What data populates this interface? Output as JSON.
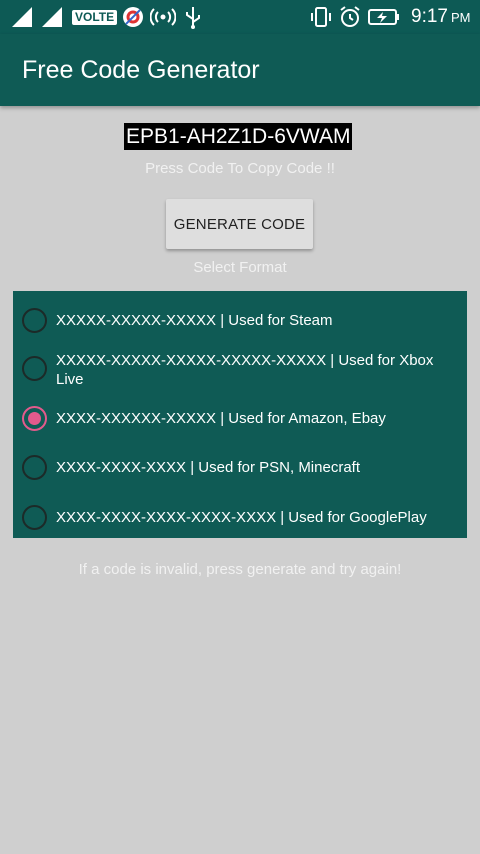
{
  "status_bar": {
    "network_badge": "VOLTE",
    "time": "9:17",
    "ampm": "PM",
    "icons": [
      "signal-icon",
      "signal-icon",
      "volte-badge",
      "app-notification-icon",
      "hotspot-icon",
      "usb-icon",
      "vibrate-icon",
      "alarm-icon",
      "battery-charging-icon"
    ]
  },
  "app_bar": {
    "title": "Free Code Generator"
  },
  "code": {
    "value": "EPB1-AH2Z1D-6VWAM",
    "hint": "Press Code To Copy Code !!"
  },
  "generate_button": {
    "label": "GENERATE CODE"
  },
  "format": {
    "label": "Select Format",
    "options": [
      {
        "text": "XXXXX-XXXXX-XXXXX | Used for Steam",
        "selected": false
      },
      {
        "text": "XXXXX-XXXXX-XXXXX-XXXXX-XXXXX | Used for Xbox Live",
        "selected": false
      },
      {
        "text": "XXXX-XXXXXX-XXXXX | Used for Amazon, Ebay",
        "selected": true
      },
      {
        "text": "XXXX-XXXX-XXXX | Used for PSN, Minecraft",
        "selected": false
      },
      {
        "text": "XXXX-XXXX-XXXX-XXXX-XXXX | Used for GooglePlay",
        "selected": false
      }
    ]
  },
  "footer_hint": "If a code is invalid, press generate and try again!",
  "colors": {
    "primary": "#0f5b55",
    "background": "#cfcfcf",
    "accent": "#e35a8c"
  }
}
